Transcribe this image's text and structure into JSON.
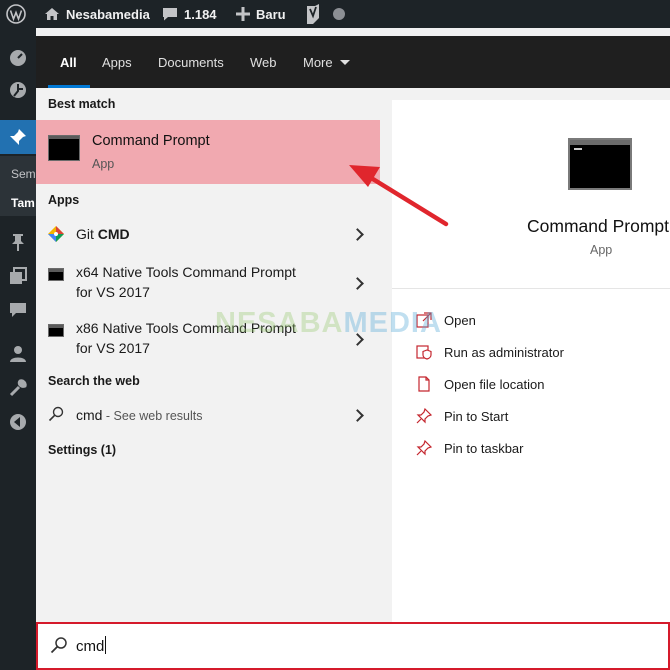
{
  "adminbar": {
    "site_name": "Nesabamedia",
    "comments_count": "1.184",
    "new_label": "Baru"
  },
  "sidebar": {
    "sub_item_1": "Sem",
    "sub_item_2": "Tam"
  },
  "tabs": [
    {
      "label": "All"
    },
    {
      "label": "Apps"
    },
    {
      "label": "Documents"
    },
    {
      "label": "Web"
    },
    {
      "label": "More"
    }
  ],
  "best_match": {
    "heading": "Best match",
    "title": "Command Prompt",
    "subtitle": "App"
  },
  "apps": {
    "heading": "Apps",
    "items": [
      {
        "prefix": "Git ",
        "bold": "CMD",
        "line2": ""
      },
      {
        "line1": "x64 Native Tools Command Prompt",
        "line2": "for VS 2017"
      },
      {
        "line1": "x86 Native Tools Command Prompt",
        "line2": "for VS 2017"
      }
    ]
  },
  "web": {
    "heading": "Search the web",
    "query": "cmd",
    "suffix": " - See web results"
  },
  "settings": {
    "heading": "Settings (1)"
  },
  "detail": {
    "title": "Command Prompt",
    "subtitle": "App",
    "actions": [
      {
        "label": "Open",
        "icon": "open-icon"
      },
      {
        "label": "Run as administrator",
        "icon": "shield-icon"
      },
      {
        "label": "Open file location",
        "icon": "file-icon"
      },
      {
        "label": "Pin to Start",
        "icon": "pin-icon"
      },
      {
        "label": "Pin to taskbar",
        "icon": "pin-icon"
      }
    ]
  },
  "watermark": {
    "part1": "NESABA",
    "part2": "MEDIA"
  },
  "search": {
    "value": "cmd"
  },
  "colors": {
    "highlight": "#f1a9b0",
    "accent": "#0078d4",
    "arrow": "#e0262d",
    "wp_dark": "#1d2327",
    "wp_blue": "#2271b1"
  }
}
